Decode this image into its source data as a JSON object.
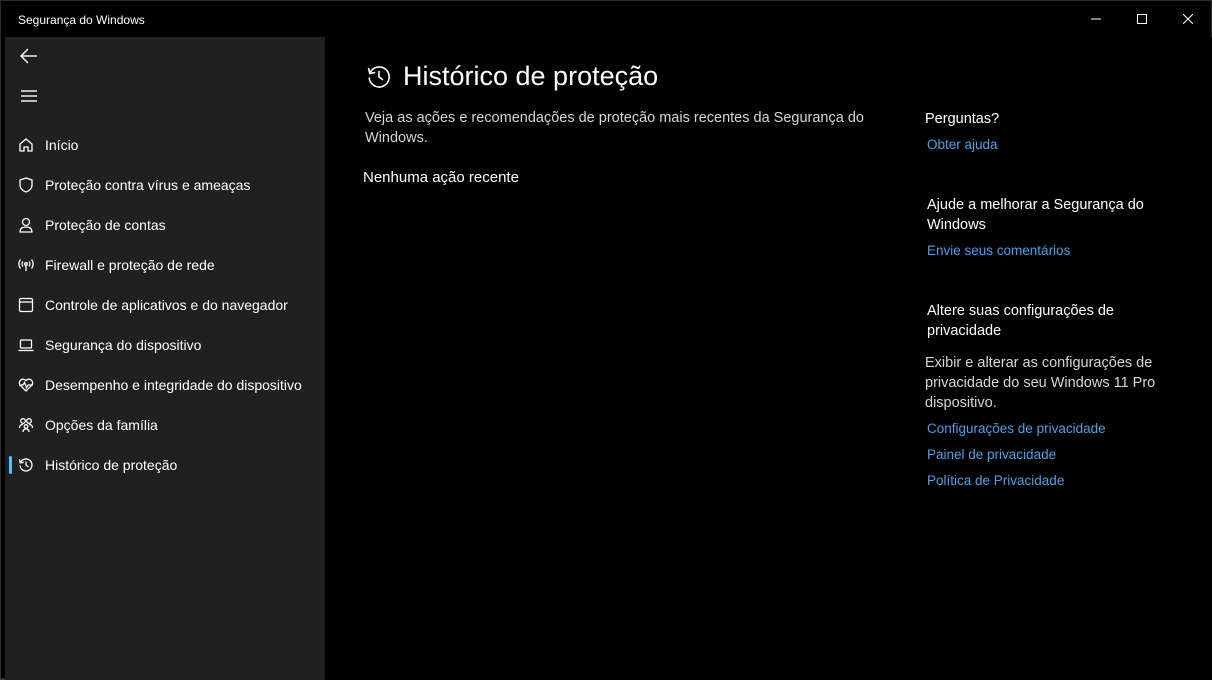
{
  "window": {
    "title": "Segurança do Windows",
    "controls": {
      "minimize": "minimize-icon",
      "maximize": "maximize-icon",
      "close": "close-icon"
    }
  },
  "sidebar": {
    "back_icon": "back-arrow-icon",
    "menu_icon": "hamburger-menu-icon",
    "items": [
      {
        "label": "Início",
        "icon": "home-icon"
      },
      {
        "label": "Proteção contra vírus e ameaças",
        "icon": "shield-icon"
      },
      {
        "label": "Proteção de contas",
        "icon": "person-icon"
      },
      {
        "label": "Firewall e proteção de rede",
        "icon": "wifi-antenna-icon"
      },
      {
        "label": "Controle de aplicativos e do navegador",
        "icon": "app-window-icon"
      },
      {
        "label": "Segurança do dispositivo",
        "icon": "laptop-icon"
      },
      {
        "label": "Desempenho e integridade do dispositivo",
        "icon": "heart-pulse-icon"
      },
      {
        "label": "Opções da família",
        "icon": "family-icon"
      },
      {
        "label": "Histórico de proteção",
        "icon": "history-icon",
        "active": true
      }
    ]
  },
  "main": {
    "title": "Histórico de proteção",
    "title_icon": "history-icon",
    "description": "Veja as ações e recomendações de proteção mais recentes da Segurança do Windows.",
    "empty_message": "Nenhuma ação recente"
  },
  "aside": {
    "questions_heading": "Perguntas?",
    "help_link": "Obter ajuda",
    "improve_heading": "Ajude a melhorar a Segurança do Windows",
    "feedback_link": "Envie seus comentários",
    "privacy_heading": "Altere suas configurações de privacidade",
    "privacy_text": "Exibir e alterar as configurações de privacidade do seu Windows 11 Pro dispositivo.",
    "privacy_links": [
      "Configurações de privacidade",
      "Painel de privacidade",
      "Política de Privacidade"
    ]
  },
  "colors": {
    "accent": "#4cc2ff",
    "link": "#4ca0e8",
    "sidebar_bg": "#202020",
    "main_bg": "#000000"
  }
}
